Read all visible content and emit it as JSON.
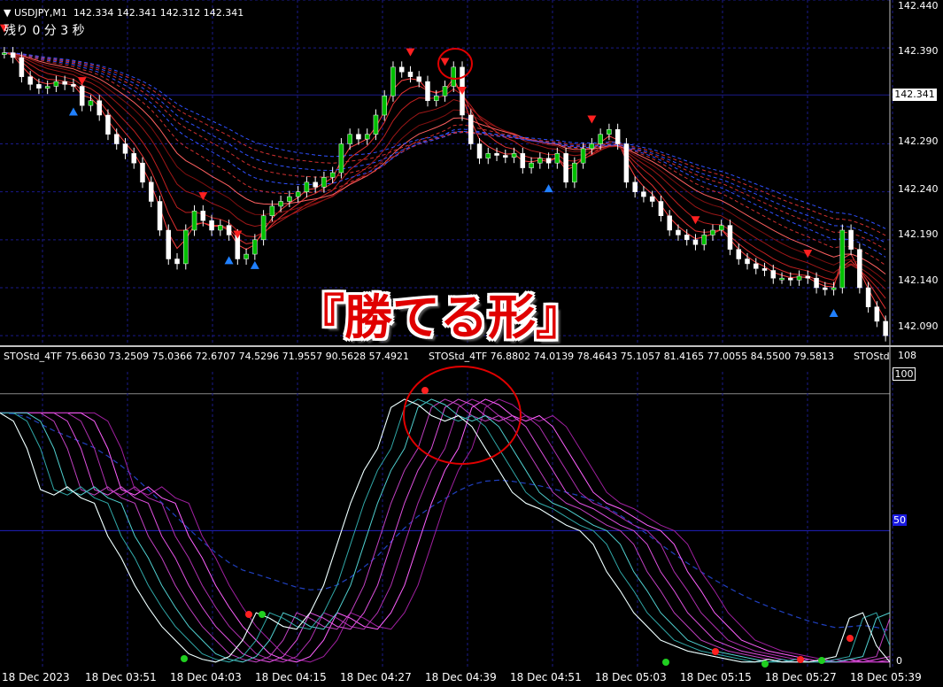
{
  "header": {
    "symbol": "USDJPY,M1",
    "ohlc": "142.334 142.341 142.312 142.341",
    "timer": "残り 0 分 3 秒"
  },
  "price_axis": {
    "ticks": [
      "142.440",
      "142.390",
      "142.290",
      "142.240",
      "142.190",
      "142.140",
      "142.090"
    ],
    "current_price": "142.341"
  },
  "overlay_title": "『勝てる形』",
  "indicator": {
    "label1": "STOStd_4TF 75.6630 73.2509 75.0366 72.6707 74.5296 71.9557 90.5628 57.4921",
    "label2": "STOStd_4TF 76.8802 74.0139 78.4643 75.1057 81.4165 77.0055 84.5500 79.5813",
    "label3": "STOStd",
    "axis_top": "108",
    "axis_100": "100",
    "axis_50": "50",
    "axis_0": "0"
  },
  "time_axis": [
    "18 Dec 2023",
    "18 Dec 03:51",
    "18 Dec 04:03",
    "18 Dec 04:15",
    "18 Dec 04:27",
    "18 Dec 04:39",
    "18 Dec 04:51",
    "18 Dec 05:03",
    "18 Dec 05:15",
    "18 Dec 05:27",
    "18 Dec 05:39"
  ],
  "colors": {
    "bull_candle": "#00c000",
    "bear_candle": "#ffffff",
    "down_arrow": "#ff2020",
    "up_arrow": "#2080ff",
    "grid": "#1a1a8a",
    "highlight_circle": "#e00000"
  },
  "chart_data": {
    "type": "line",
    "closes": [
      142.385,
      142.38,
      142.36,
      142.352,
      142.348,
      142.35,
      142.355,
      142.352,
      142.35,
      142.33,
      142.335,
      142.32,
      142.3,
      142.29,
      142.28,
      142.27,
      142.25,
      142.23,
      142.2,
      142.17,
      142.165,
      142.2,
      142.22,
      142.21,
      142.2,
      142.205,
      142.195,
      142.17,
      142.175,
      142.19,
      142.215,
      142.225,
      142.23,
      142.235,
      142.24,
      142.25,
      142.245,
      142.255,
      142.26,
      142.29,
      142.3,
      142.295,
      142.3,
      142.32,
      142.34,
      142.37,
      142.365,
      142.36,
      142.355,
      142.335,
      142.34,
      142.35,
      142.37,
      142.32,
      142.29,
      142.275,
      142.28,
      142.278,
      142.276,
      142.28,
      142.265,
      142.27,
      142.275,
      142.27,
      142.28,
      142.25,
      142.27,
      142.285,
      142.29,
      142.3,
      142.305,
      142.29,
      142.25,
      142.24,
      142.235,
      142.23,
      142.215,
      142.2,
      142.195,
      142.19,
      142.185,
      142.195,
      142.2,
      142.205,
      142.18,
      142.17,
      142.165,
      142.16,
      142.158,
      142.15,
      142.15,
      142.148,
      142.152,
      142.15,
      142.14,
      142.138,
      142.14,
      142.2,
      142.18,
      142.14,
      142.12,
      142.105,
      142.09
    ],
    "ylim": [
      142.08,
      142.44
    ],
    "oscillator": [
      93,
      90,
      80,
      65,
      63,
      66,
      62,
      60,
      48,
      40,
      30,
      22,
      15,
      10,
      5,
      3,
      2,
      4,
      10,
      20,
      18,
      15,
      14,
      20,
      30,
      45,
      60,
      72,
      80,
      95,
      98,
      96,
      92,
      90,
      92,
      88,
      80,
      72,
      64,
      60,
      58,
      55,
      52,
      50,
      45,
      35,
      28,
      20,
      15,
      10,
      8,
      6,
      5,
      4,
      3,
      2,
      2,
      3,
      2,
      2,
      2,
      3,
      4,
      18,
      20,
      8,
      2
    ],
    "osc_ylim": [
      0,
      108
    ]
  }
}
